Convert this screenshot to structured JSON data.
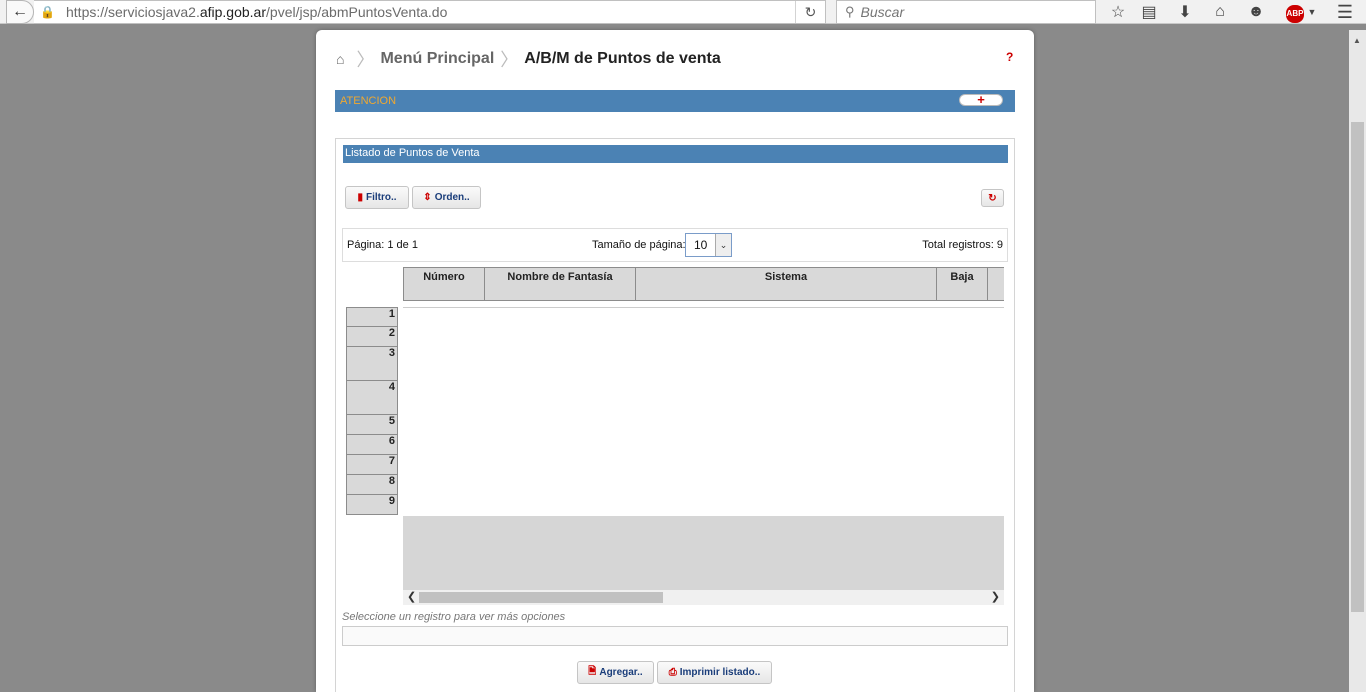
{
  "browser": {
    "url_prefix": "https://serviciosjava2.",
    "url_domain": "afip.gob.ar",
    "url_path": "/pvel/jsp/abmPuntosVenta.do",
    "search_placeholder": "Buscar",
    "abp_label": "ABP"
  },
  "breadcrumb": {
    "home_label": "Menú Principal",
    "current": "A/B/M de Puntos de venta",
    "help": "?"
  },
  "atencion": {
    "label": "ATENCION",
    "toggle": "+"
  },
  "listado": {
    "title": "Listado de Puntos de Venta",
    "filter_button": "Filtro..",
    "order_button": "Orden..",
    "pager": {
      "page_text": "Página: 1 de 1",
      "page_size_label": "Tamaño de página:",
      "page_size_value": "10",
      "total_text": "Total registros: 9"
    },
    "columns": [
      "Número",
      "Nombre de Fantasía",
      "Sistema",
      "Baja"
    ],
    "rows": [
      "1",
      "2",
      "3",
      "4",
      "5",
      "6",
      "7",
      "8",
      "9"
    ],
    "hint": "Seleccione un registro para ver más opciones",
    "add_button": "Agregar..",
    "print_button": "Imprimir listado.."
  }
}
